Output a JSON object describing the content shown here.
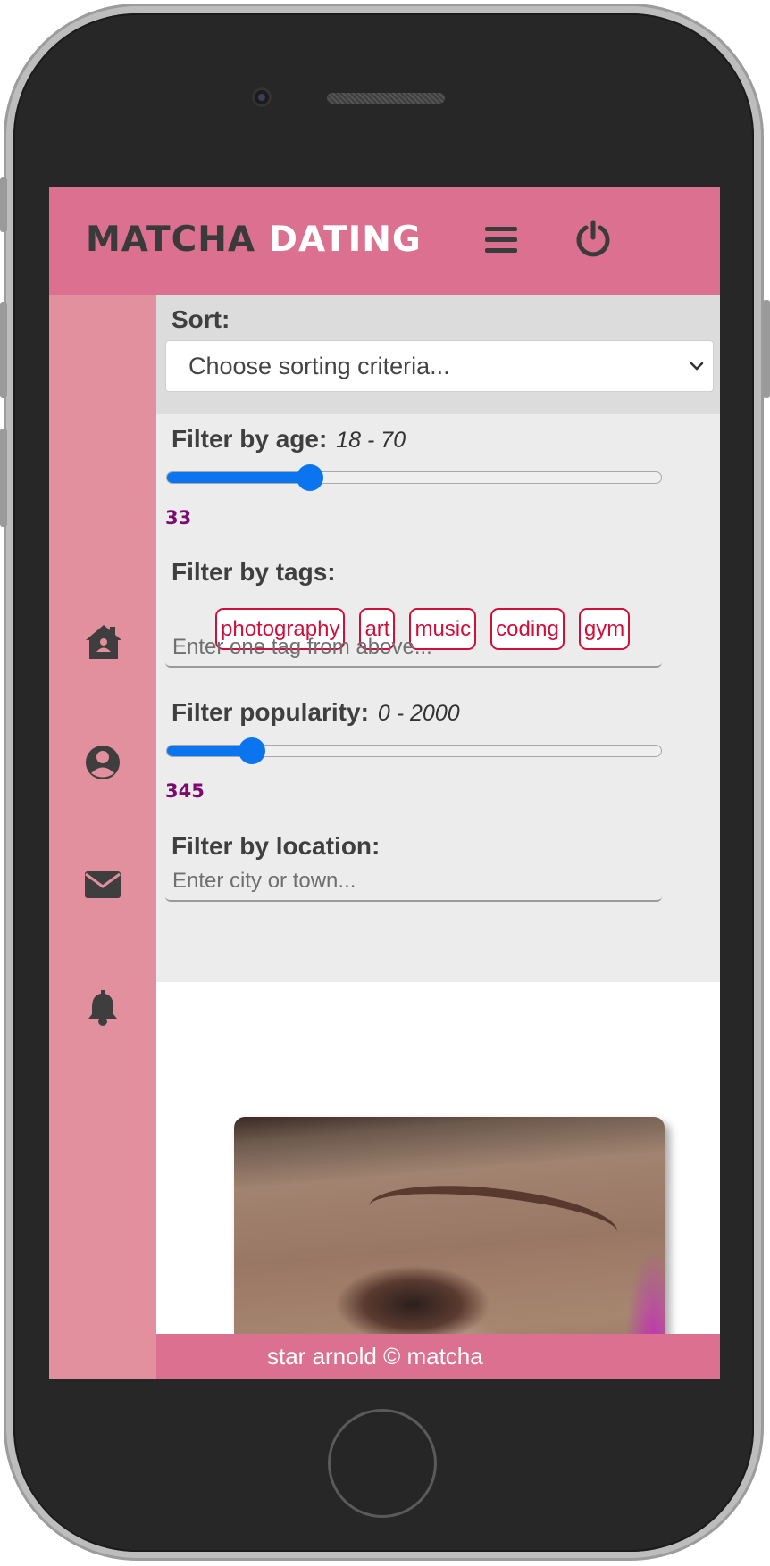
{
  "header": {
    "brand_part1": "MATCHA",
    "brand_part2": "DATING",
    "menu_icon": "hamburger-icon",
    "power_icon": "power-icon"
  },
  "sidebar": {
    "items": [
      {
        "icon": "home-icon"
      },
      {
        "icon": "user-circle-icon"
      },
      {
        "icon": "envelope-icon"
      },
      {
        "icon": "bell-icon"
      }
    ]
  },
  "sort": {
    "label": "Sort:",
    "selected": "Choose sorting criteria..."
  },
  "filters": {
    "age": {
      "label": "Filter by age:",
      "range": "18 - 70",
      "value": "33",
      "min": 18,
      "max": 70,
      "current": 33
    },
    "tags": {
      "label": "Filter by tags:",
      "items": [
        "photography",
        "art",
        "music",
        "coding",
        "gym"
      ],
      "placeholder": "Enter one tag from above..."
    },
    "popularity": {
      "label": "Filter popularity:",
      "range": "0 - 2000",
      "value": "345",
      "min": 0,
      "max": 2000,
      "current": 345
    },
    "location": {
      "label": "Filter by location:",
      "placeholder": "Enter city or town..."
    }
  },
  "footer": {
    "text": "star arnold © matcha"
  },
  "colors": {
    "header_bg": "#db7090",
    "sidebar_bg": "#e2909e",
    "slider_accent": "#0a75ee",
    "tag_color": "#d0103a",
    "value_color": "#7d0a70"
  }
}
